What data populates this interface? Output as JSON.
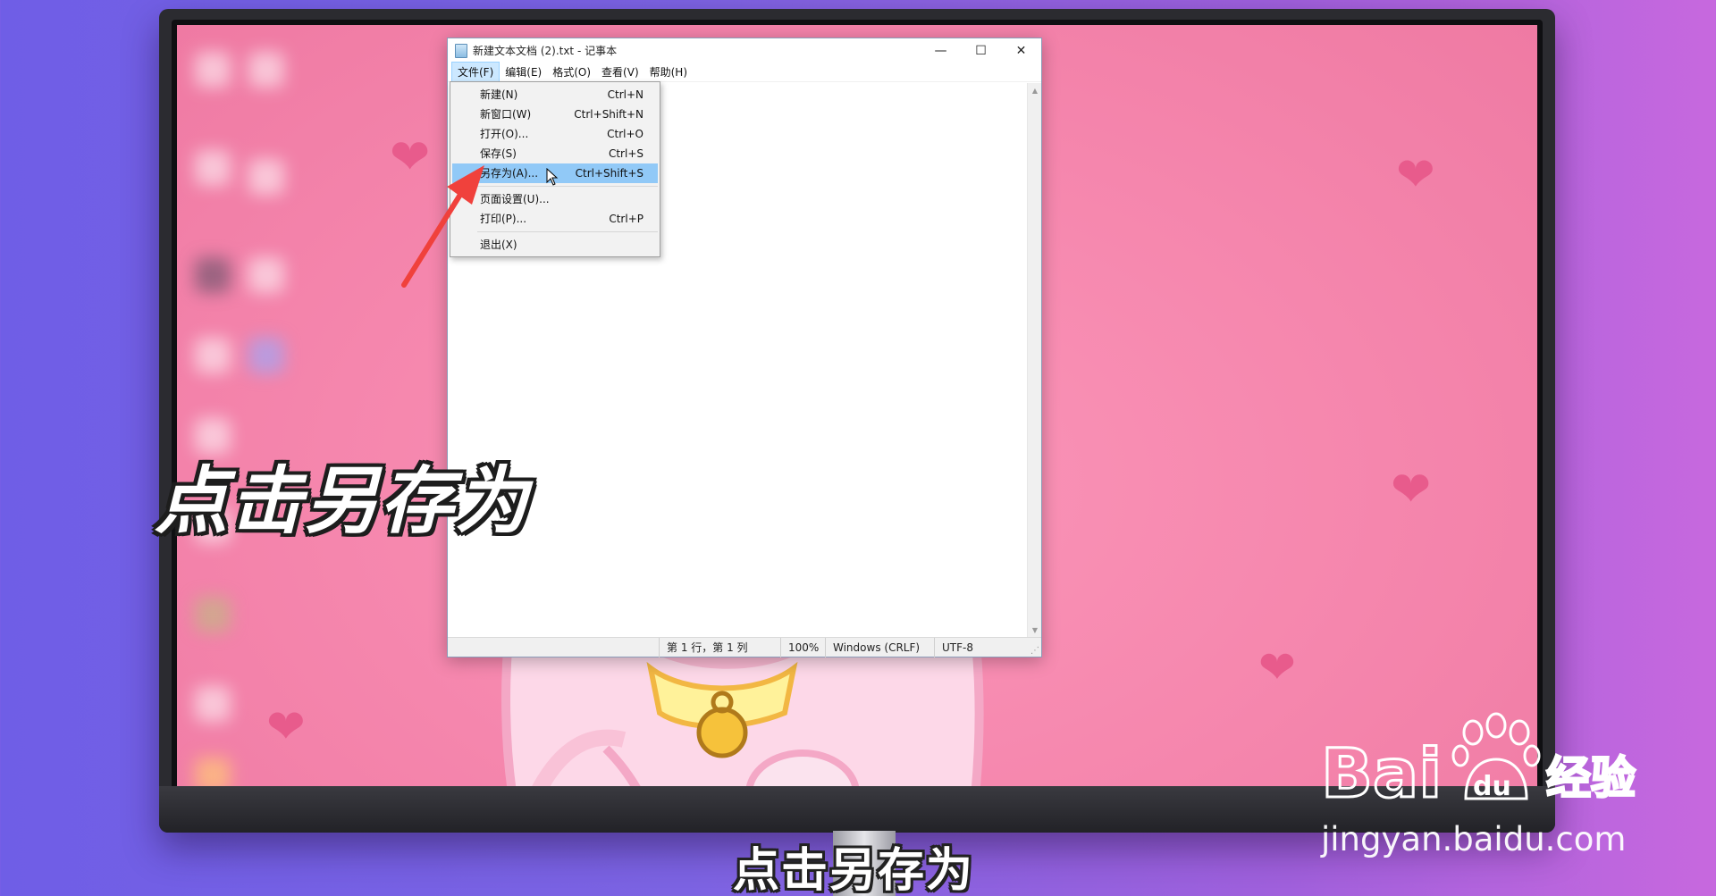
{
  "notepad": {
    "title": "新建文本文档 (2).txt - 记事本",
    "window_controls": {
      "minimize": "—",
      "maximize": "☐",
      "close": "✕"
    },
    "menubar": [
      {
        "label": "文件(F)",
        "active": true
      },
      {
        "label": "编辑(E)"
      },
      {
        "label": "格式(O)"
      },
      {
        "label": "查看(V)"
      },
      {
        "label": "帮助(H)"
      }
    ],
    "file_menu": [
      {
        "label": "新建(N)",
        "shortcut": "Ctrl+N"
      },
      {
        "label": "新窗口(W)",
        "shortcut": "Ctrl+Shift+N"
      },
      {
        "label": "打开(O)...",
        "shortcut": "Ctrl+O"
      },
      {
        "label": "保存(S)",
        "shortcut": "Ctrl+S"
      },
      {
        "label": "另存为(A)...",
        "shortcut": "Ctrl+Shift+S",
        "highlighted": true
      },
      {
        "label": "页面设置(U)...",
        "shortcut": ""
      },
      {
        "label": "打印(P)...",
        "shortcut": "Ctrl+P"
      },
      {
        "label": "退出(X)",
        "shortcut": ""
      }
    ],
    "statusbar": {
      "position": "第 1 行，第 1 列",
      "zoom": "100%",
      "line_ending": "Windows (CRLF)",
      "encoding": "UTF-8"
    }
  },
  "captions": {
    "big": "点击另存为",
    "subtitle": "点击另存为"
  },
  "watermark": {
    "brand_latin": "Bai",
    "brand_du": "du",
    "brand_cn": "经验",
    "url": "jingyan.baidu.com"
  },
  "colors": {
    "wallpaper_pink": "#f586ad",
    "heart": "#e85b8c",
    "menu_highlight": "#91c9f7",
    "annotation_arrow": "#f0413c"
  }
}
